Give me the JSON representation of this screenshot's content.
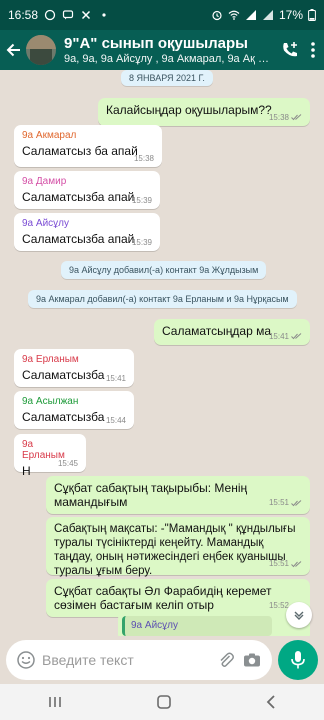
{
  "status": {
    "time": "16:58",
    "battery": "17%"
  },
  "header": {
    "title": "9\"А\" сынып оқушылары",
    "subtitle": "9а, 9а, 9а Айсұлу , 9а Акмарал, 9а Ақ Ер..."
  },
  "chat": {
    "date": "8 ЯНВАРЯ 2021 Г.",
    "messages": [
      {
        "text": "Калайсыңдар оқушыларым??",
        "time": "15:38"
      },
      {
        "sender": "9а Акмарал",
        "text": "Саламатсыз ба апай",
        "time": "15:38"
      },
      {
        "sender": "9а Дамир",
        "text": "Саламатсызба апай",
        "time": "15:39"
      },
      {
        "sender": "9а Айсұлу",
        "text": "Саламатсызба апай",
        "time": "15:39"
      },
      {
        "system": "9а Айсұлу добавил(-а) контакт 9а Жұлдызым"
      },
      {
        "system": "9а Акмарал добавил(-а) контакт 9а Ерланым и 9а Нұрқасым"
      },
      {
        "text": "Саламатсыңдар ма",
        "time": "15:41"
      },
      {
        "sender": "9а Ерланым",
        "text": "Саламатсызба",
        "time": "15:41"
      },
      {
        "sender": "9а Асылжан",
        "text": "Саламатсызба",
        "time": "15:44"
      },
      {
        "sender": "9а Ерланым",
        "text": "Н",
        "time": "15:45"
      },
      {
        "text": "Сұқбат сабақтың тақырыбы: Менің мамандығым",
        "time": "15:51"
      },
      {
        "text": "Сабақтың мақсаты: -\"Мамандық \" құндылығы туралы түсініктерді кеңейту. Мамандық таңдау, оның нәтижесіндегі еңбек қуанышы туралы ұғым беру.",
        "time": "15:51"
      },
      {
        "text": "Сұқбат сабақты Әл Фарабидің керемет сөзімен бастағым келіп отыр",
        "time": "15:52"
      },
      {
        "reply": "9а Айсұлу"
      }
    ]
  },
  "input": {
    "placeholder": "Введите текст"
  },
  "colors": {
    "header": "#075e54",
    "status": "#054d44",
    "chat_bg": "#e5ddd5",
    "outgoing": "#dcf8c6",
    "incoming": "#ffffff",
    "accent": "#00a884",
    "sender_akmaral": "#e0682f",
    "sender_damir": "#d44fa6",
    "sender_aisulu": "#7a4bd4",
    "sender_erlan": "#d83b4a",
    "sender_asylzhan": "#1f9b3a"
  },
  "icons": {
    "back": "back-arrow-icon",
    "add_call": "add-call-icon",
    "menu": "more-vert-icon",
    "emoji": "emoji-icon",
    "attach": "attach-icon",
    "camera": "camera-icon",
    "mic": "mic-icon",
    "read_receipt": "double-check-icon",
    "scroll_down": "chevron-down-icon"
  }
}
